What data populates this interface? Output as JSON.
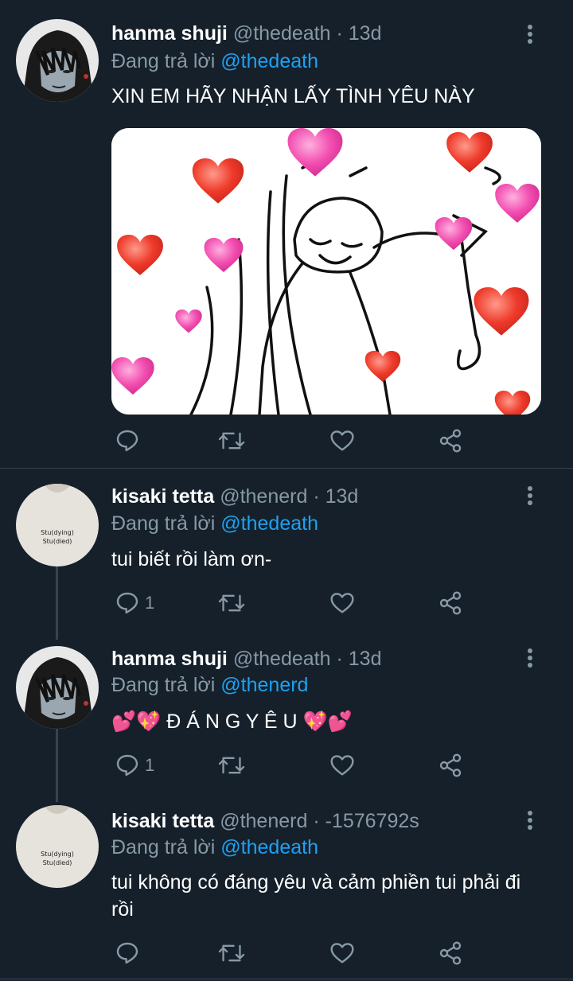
{
  "tweets": [
    {
      "name": "hanma shuji",
      "handle": "@thedeath",
      "time": "· 13d",
      "reply_prefix": "Đang trả lời ",
      "reply_to": "@thedeath",
      "text": "XIN EM HÃY NHẬN LẤY TÌNH YÊU NÀY",
      "reply_count": "",
      "avatar_icon": "anime-avatar-icon",
      "has_media": true
    },
    {
      "name": "kisaki tetta",
      "handle": "@thenerd",
      "time": "· 13d",
      "reply_prefix": "Đang trả lời ",
      "reply_to": "@thedeath",
      "text": "tui biết rồi làm ơn-",
      "reply_count": "1",
      "avatar_icon": "shirt-avatar-icon",
      "avatar_text_1": "Stu(dying)",
      "avatar_text_2": "Stu(died)"
    },
    {
      "name": "hanma shuji",
      "handle": "@thedeath",
      "time": "· 13d",
      "reply_prefix": "Đang trả lời ",
      "reply_to": "@thenerd",
      "text": "💕💖 Đ Á N G Y Ê U 💖💕",
      "reply_count": "1",
      "avatar_icon": "anime-avatar-icon"
    },
    {
      "name": "kisaki tetta",
      "handle": "@thenerd",
      "time": "· -1576792s",
      "reply_prefix": "Đang trả lời ",
      "reply_to": "@thedeath",
      "text": "tui không có đáng yêu và cảm phiền tui phải đi rồi",
      "reply_count": "",
      "avatar_icon": "shirt-avatar-icon",
      "avatar_text_1": "Stu(dying)",
      "avatar_text_2": "Stu(died)"
    }
  ],
  "colors": {
    "background": "#15202b",
    "secondary_text": "#8899a6",
    "mention": "#1da1f2",
    "divider": "#38444d"
  }
}
